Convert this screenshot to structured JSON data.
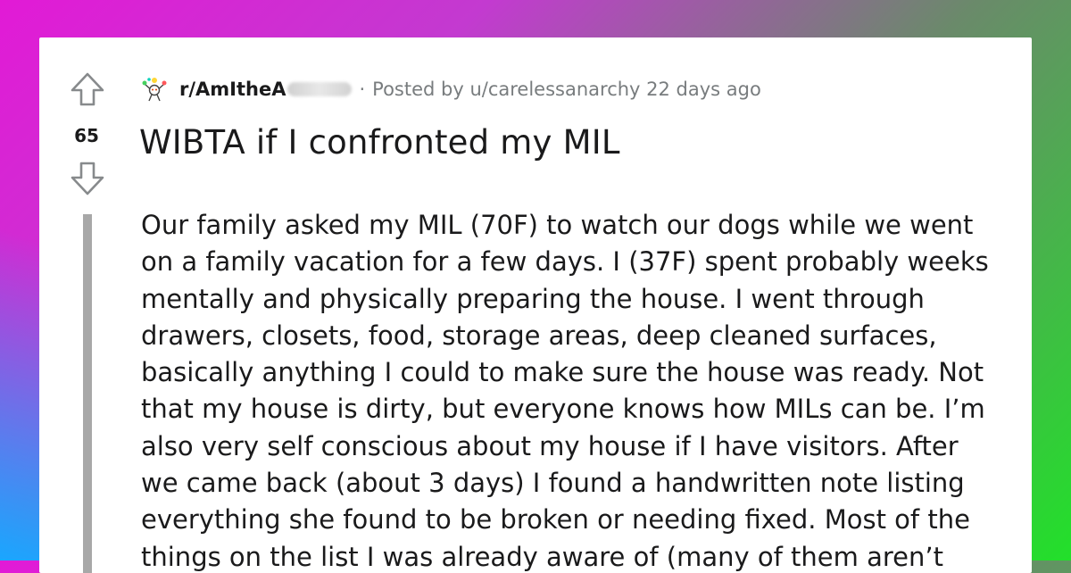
{
  "post": {
    "subreddit": "r/AmItheA",
    "separator": "·",
    "posted_by_text": "Posted by u/carelessanarchy 22 days ago",
    "score": "65",
    "title": "WIBTA if I confronted my MIL",
    "body_lines": [
      "Our family asked my MIL (70F) to watch our dogs while we went",
      "on a family vacation for a few days. I (37F) spent probably weeks",
      "mentally and physically preparing the house. I went through",
      "drawers, closets, food, storage areas, deep cleaned surfaces,",
      "basically anything I could to make sure the house was ready. Not",
      "that my house is dirty, but everyone knows how MILs can be. I’m",
      "also very self conscious about my house if I have visitors. After",
      "we came back (about 3 days) I found a handwritten note listing",
      "everything she found to be broken or needing fixed. Most of the",
      "things on the list I was already aware of (many of them aren’t"
    ]
  },
  "icons": {
    "upvote": "upvote-arrow-icon",
    "downvote": "downvote-arrow-icon",
    "subreddit": "subreddit-snoo-icon"
  },
  "colors": {
    "text": "#1a1a1b",
    "meta": "#787c7e",
    "thread_line": "#a8a8a8"
  }
}
